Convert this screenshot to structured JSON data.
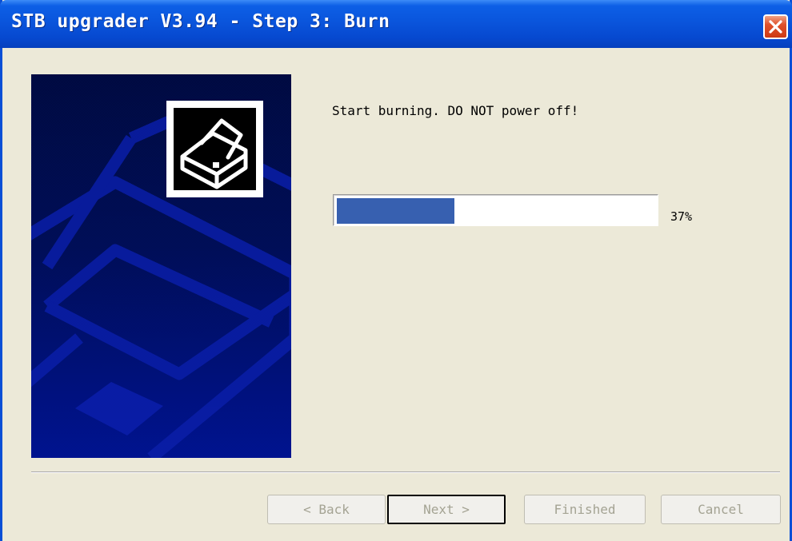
{
  "window": {
    "title": "STB upgrader V3.94 - Step 3: Burn"
  },
  "banner": {
    "icon": "printer-icon"
  },
  "main": {
    "message": "Start burning. DO NOT power off!",
    "progress_value": 0.37,
    "progress_text": "37%"
  },
  "buttons": {
    "back": "< Back",
    "next": "Next >",
    "finished": "Finished",
    "cancel": "Cancel"
  },
  "colors": {
    "title_bar": "#0a55dc",
    "progress_fill": "#3760b0",
    "banner_bg": "#000a40",
    "close_button": "#e0512c"
  }
}
